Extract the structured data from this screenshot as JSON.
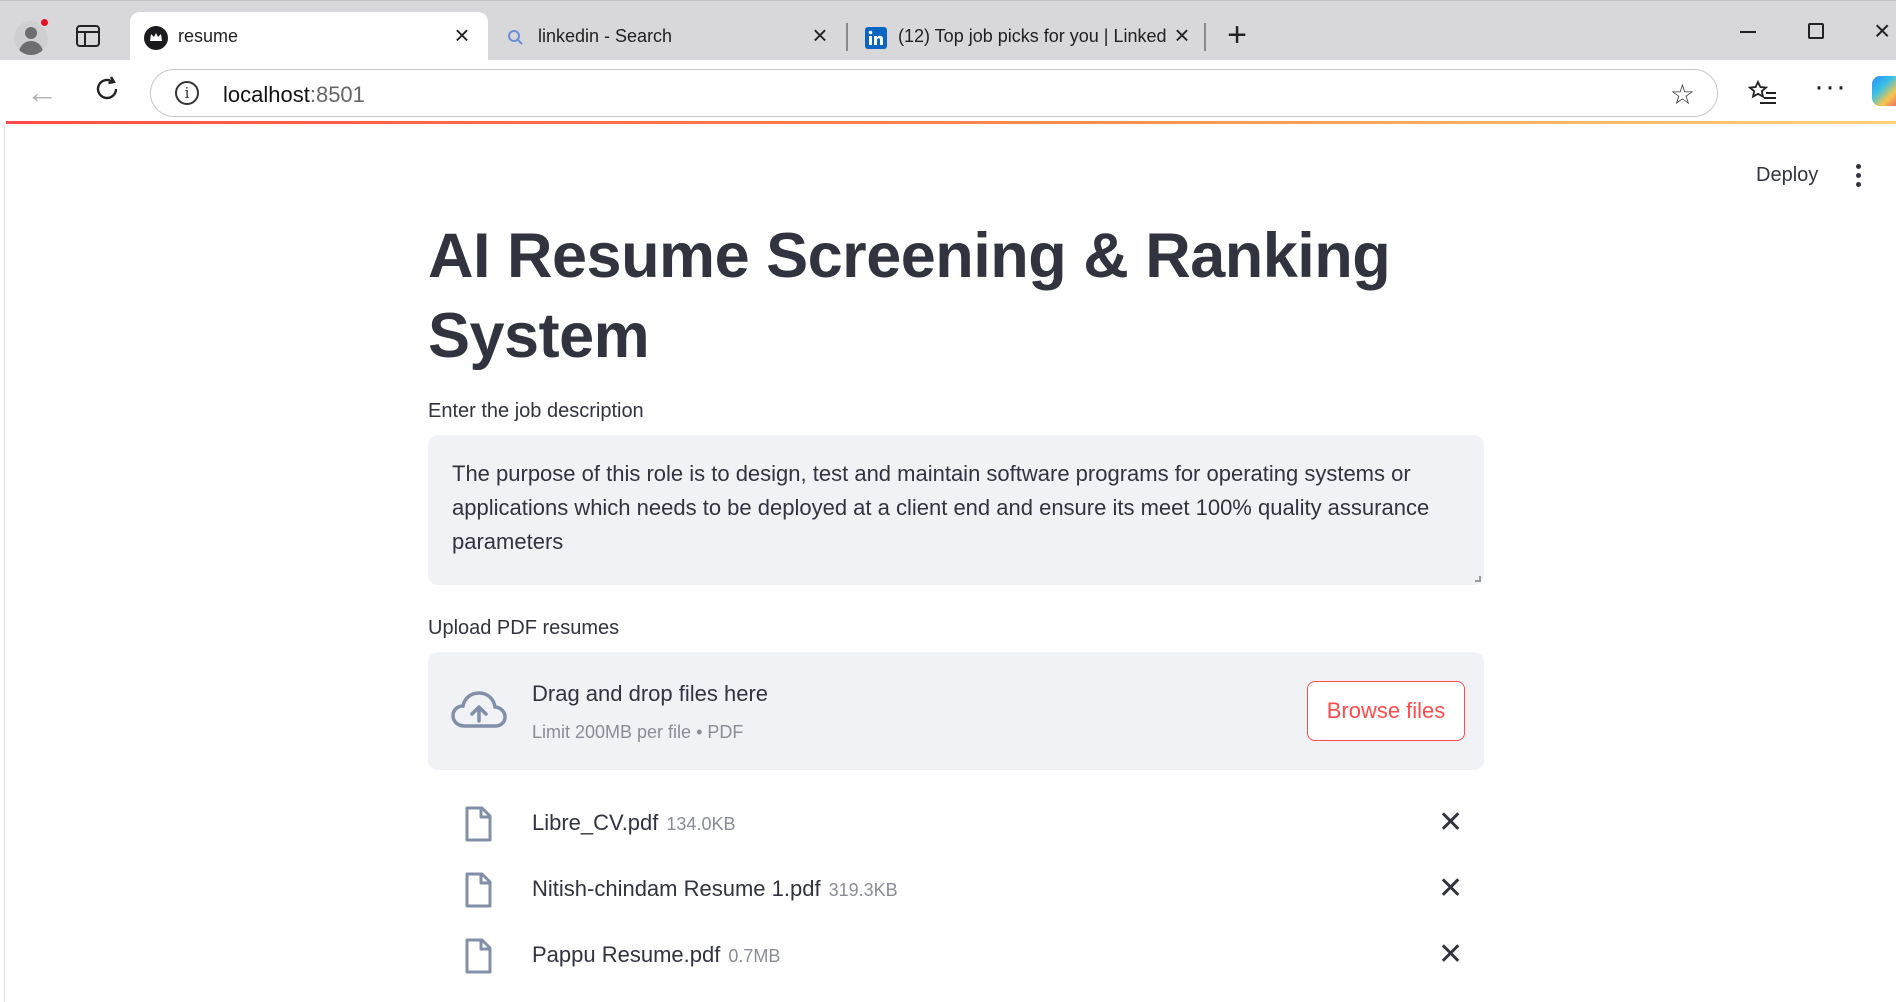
{
  "browser": {
    "tabs": [
      {
        "title": "resume",
        "active": true,
        "favicon": "streamlit-crown-icon"
      },
      {
        "title": "linkedin - Search",
        "active": false,
        "favicon": "search-icon"
      },
      {
        "title": "(12) Top job picks for you | Linked",
        "active": false,
        "favicon": "linkedin-icon"
      }
    ],
    "url": {
      "host": "localhost",
      "port": ":8501"
    }
  },
  "app": {
    "deploy_label": "Deploy",
    "title": "AI Resume Screening & Ranking System",
    "job_description": {
      "label": "Enter the job description",
      "value": "The purpose of this role is to design, test and maintain software programs for operating systems or applications which needs to be deployed at a client end and ensure its meet 100% quality assurance parameters"
    },
    "upload": {
      "label": "Upload PDF resumes",
      "drop_title": "Drag and drop files here",
      "drop_subtitle": "Limit 200MB per file • PDF",
      "browse_label": "Browse files",
      "files": [
        {
          "name": "Libre_CV.pdf",
          "size": "134.0KB"
        },
        {
          "name": "Nitish-chindam Resume 1.pdf",
          "size": "319.3KB"
        },
        {
          "name": "Pappu Resume.pdf",
          "size": "0.7MB"
        }
      ]
    }
  },
  "colors": {
    "accent": "#ff4b4b",
    "text": "#31333f",
    "muted": "#8a8d96",
    "input_bg": "#f0f2f6"
  }
}
